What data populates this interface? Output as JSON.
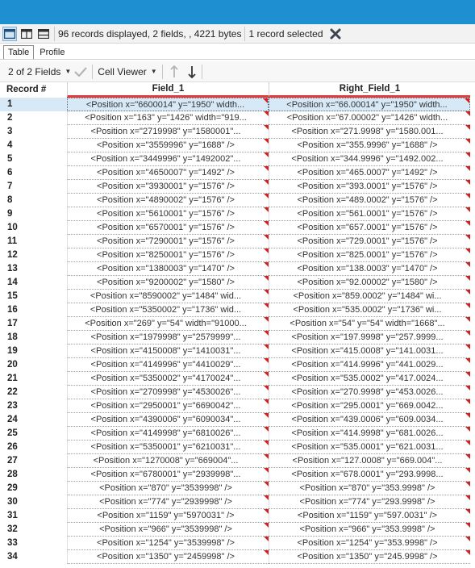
{
  "statusbar": {
    "records_text": "96 records displayed, 2 fields, , 4221 bytes",
    "selected_text": "1 record selected"
  },
  "tabs": [
    {
      "label": "Table",
      "active": true
    },
    {
      "label": "Profile",
      "active": false
    }
  ],
  "toolbar": {
    "fields_text": "2 of 2 Fields",
    "viewer_text": "Cell Viewer"
  },
  "colors": {
    "accent": "#1e8fd0",
    "header_underline": "#e33b3b",
    "flag": "#d42020",
    "selected_row": "#d7e8f6"
  },
  "table": {
    "headers": [
      "Record #",
      "Field_1",
      "Right_Field_1"
    ],
    "rows": [
      {
        "n": "1",
        "f1": "<Position x=\"6600014\" y=\"1950\" width...",
        "f2": "<Position x=\"66.00014\" y=\"1950\" width..."
      },
      {
        "n": "2",
        "f1": "<Position x=\"163\" y=\"1426\" width=\"919...",
        "f2": "<Position x=\"67.00002\" y=\"1426\" width..."
      },
      {
        "n": "3",
        "f1": "<Position x=\"2719998\" y=\"1580001\"...",
        "f2": "<Position x=\"271.9998\" y=\"1580.001..."
      },
      {
        "n": "4",
        "f1": "<Position x=\"3559996\" y=\"1688\" />",
        "f2": "<Position x=\"355.9996\" y=\"1688\" />"
      },
      {
        "n": "5",
        "f1": "<Position x=\"3449996\" y=\"1492002\"...",
        "f2": "<Position x=\"344.9996\" y=\"1492.002..."
      },
      {
        "n": "6",
        "f1": "<Position x=\"4650007\" y=\"1492\" />",
        "f2": "<Position x=\"465.0007\" y=\"1492\" />"
      },
      {
        "n": "7",
        "f1": "<Position x=\"3930001\" y=\"1576\" />",
        "f2": "<Position x=\"393.0001\" y=\"1576\" />"
      },
      {
        "n": "8",
        "f1": "<Position x=\"4890002\" y=\"1576\" />",
        "f2": "<Position x=\"489.0002\" y=\"1576\" />"
      },
      {
        "n": "9",
        "f1": "<Position x=\"5610001\" y=\"1576\" />",
        "f2": "<Position x=\"561.0001\" y=\"1576\" />"
      },
      {
        "n": "10",
        "f1": "<Position x=\"6570001\" y=\"1576\" />",
        "f2": "<Position x=\"657.0001\" y=\"1576\" />"
      },
      {
        "n": "11",
        "f1": "<Position x=\"7290001\" y=\"1576\" />",
        "f2": "<Position x=\"729.0001\" y=\"1576\" />"
      },
      {
        "n": "12",
        "f1": "<Position x=\"8250001\" y=\"1576\" />",
        "f2": "<Position x=\"825.0001\" y=\"1576\" />"
      },
      {
        "n": "13",
        "f1": "<Position x=\"1380003\" y=\"1470\" />",
        "f2": "<Position x=\"138.0003\" y=\"1470\" />"
      },
      {
        "n": "14",
        "f1": "<Position x=\"9200002\" y=\"1580\" />",
        "f2": "<Position x=\"92.00002\" y=\"1580\" />"
      },
      {
        "n": "15",
        "f1": "<Position x=\"8590002\" y=\"1484\" wid...",
        "f2": "<Position x=\"859.0002\" y=\"1484\" wi..."
      },
      {
        "n": "16",
        "f1": "<Position x=\"5350002\" y=\"1736\" wid...",
        "f2": "<Position x=\"535.0002\" y=\"1736\" wi..."
      },
      {
        "n": "17",
        "f1": "<Position x=\"269\" y=\"54\" width=\"91000...",
        "f2": "<Position x=\"54\" y=\"54\" width=\"1668\"..."
      },
      {
        "n": "18",
        "f1": "<Position x=\"1979998\" y=\"2579999\"...",
        "f2": "<Position x=\"197.9998\" y=\"257.9999..."
      },
      {
        "n": "19",
        "f1": "<Position x=\"4150008\" y=\"1410031\"...",
        "f2": "<Position x=\"415.0008\" y=\"141.0031..."
      },
      {
        "n": "20",
        "f1": "<Position x=\"4149996\" y=\"4410029\"...",
        "f2": "<Position x=\"414.9996\" y=\"441.0029..."
      },
      {
        "n": "21",
        "f1": "<Position x=\"5350002\" y=\"4170024\"...",
        "f2": "<Position x=\"535.0002\" y=\"417.0024..."
      },
      {
        "n": "22",
        "f1": "<Position x=\"2709998\" y=\"4530026\"...",
        "f2": "<Position x=\"270.9998\" y=\"453.0026..."
      },
      {
        "n": "23",
        "f1": "<Position x=\"2950001\" y=\"6690042\"...",
        "f2": "<Position x=\"295.0001\" y=\"669.0042..."
      },
      {
        "n": "24",
        "f1": "<Position x=\"4390006\" y=\"6090034\"...",
        "f2": "<Position x=\"439.0006\" y=\"609.0034..."
      },
      {
        "n": "25",
        "f1": "<Position x=\"4149998\" y=\"6810026\"...",
        "f2": "<Position x=\"414.9998\" y=\"681.0026..."
      },
      {
        "n": "26",
        "f1": "<Position x=\"5350001\" y=\"6210031\"...",
        "f2": "<Position x=\"535.0001\" y=\"621.0031..."
      },
      {
        "n": "27",
        "f1": "<Position x=\"1270008\" y=\"669004\"...",
        "f2": "<Position x=\"127.0008\" y=\"669.004\"..."
      },
      {
        "n": "28",
        "f1": "<Position x=\"6780001\" y=\"2939998\"...",
        "f2": "<Position x=\"678.0001\" y=\"293.9998..."
      },
      {
        "n": "29",
        "f1": "<Position x=\"870\" y=\"3539998\" />",
        "f2": "<Position x=\"870\" y=\"353.9998\" />"
      },
      {
        "n": "30",
        "f1": "<Position x=\"774\" y=\"2939998\" />",
        "f2": "<Position x=\"774\" y=\"293.9998\" />"
      },
      {
        "n": "31",
        "f1": "<Position x=\"1159\" y=\"5970031\" />",
        "f2": "<Position x=\"1159\" y=\"597.0031\" />"
      },
      {
        "n": "32",
        "f1": "<Position x=\"966\" y=\"3539998\" />",
        "f2": "<Position x=\"966\" y=\"353.9998\" />"
      },
      {
        "n": "33",
        "f1": "<Position x=\"1254\" y=\"3539998\" />",
        "f2": "<Position x=\"1254\" y=\"353.9998\" />"
      },
      {
        "n": "34",
        "f1": "<Position x=\"1350\" y=\"2459998\" />",
        "f2": "<Position x=\"1350\" y=\"245.9998\" />"
      }
    ]
  }
}
